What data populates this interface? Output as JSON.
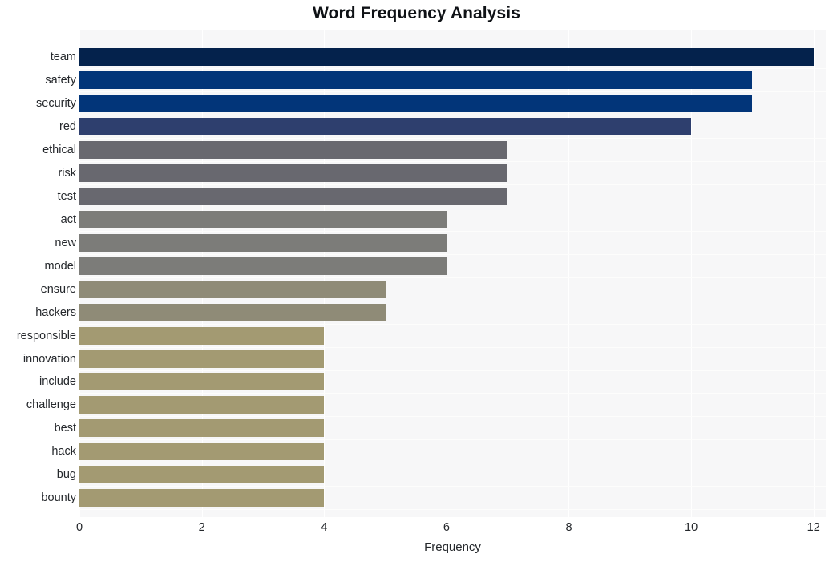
{
  "chart_data": {
    "type": "bar",
    "orientation": "horizontal",
    "title": "Word Frequency Analysis",
    "xlabel": "Frequency",
    "ylabel": "",
    "xlim": [
      0,
      12.2
    ],
    "xticks": [
      0,
      2,
      4,
      6,
      8,
      10,
      12
    ],
    "xtick_labels": [
      "0",
      "2",
      "4",
      "6",
      "8",
      "10",
      "12"
    ],
    "grid": true,
    "legend": "none",
    "categories": [
      "team",
      "safety",
      "security",
      "red",
      "ethical",
      "risk",
      "test",
      "act",
      "new",
      "model",
      "ensure",
      "hackers",
      "responsible",
      "innovation",
      "include",
      "challenge",
      "best",
      "hack",
      "bug",
      "bounty"
    ],
    "values": [
      12,
      11,
      11,
      10,
      7,
      7,
      7,
      6,
      6,
      6,
      5,
      5,
      4,
      4,
      4,
      4,
      4,
      4,
      4,
      4
    ],
    "bar_colors": [
      "#04224c",
      "#023579",
      "#023579",
      "#2e3f६e",
      "#68686f",
      "#68686f",
      "#68686f",
      "#7c7c79",
      "#7c7c79",
      "#7c7c79",
      "#8f8b77",
      "#8f8b77",
      "#a39a72",
      "#a39a72",
      "#a39a72",
      "#a39a72",
      "#a39a72",
      "#a39a72",
      "#a39a72",
      "#a39a72"
    ],
    "plot_background": "#f7f7f8",
    "gridline_color": "#ffffff",
    "title_color": "#0f1216",
    "tick_color": "#25282c"
  }
}
